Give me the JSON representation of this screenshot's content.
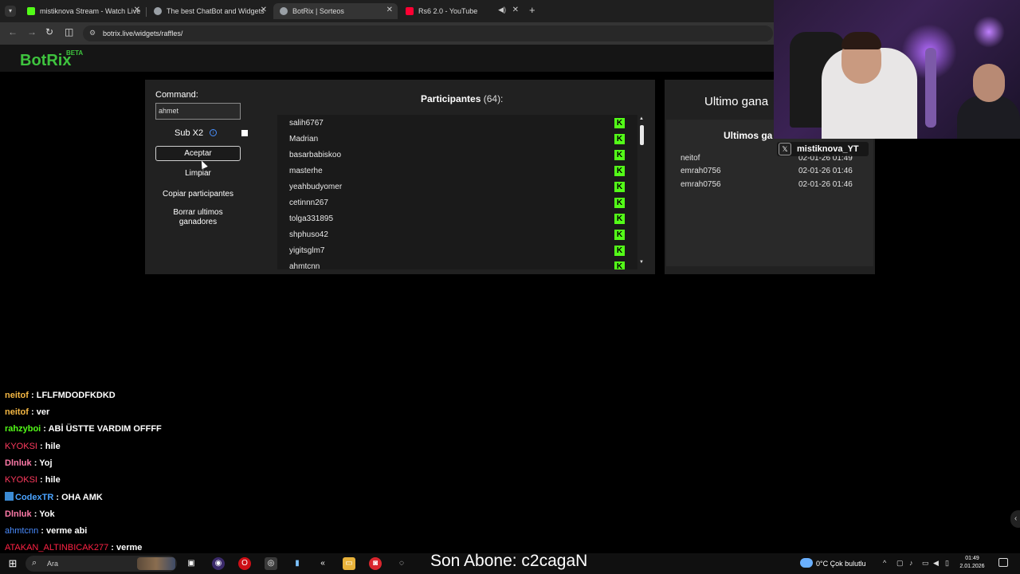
{
  "browser": {
    "tabs": [
      {
        "title": "mistiknova Stream - Watch Live",
        "color": "#53fc18"
      },
      {
        "title": "The best ChatBot and Widgets",
        "color": "#9aa0a6"
      },
      {
        "title": "BotRix | Sorteos",
        "color": "#9aa0a6"
      },
      {
        "title": "Rs6 2.0 - YouTube",
        "color": "#ff0033"
      }
    ],
    "close_glyph": "✕",
    "new_tab_glyph": "+",
    "url": "botrix.live/widgets/raffles/"
  },
  "app": {
    "logo": "BotRix",
    "logo_badge": "BETA",
    "command_label": "Command:",
    "command_value": "ahmet",
    "sub_label": "Sub X2",
    "buttons": {
      "accept": "Aceptar",
      "clear": "Limpiar",
      "copy": "Copiar participantes",
      "delete": "Borrar ultimos ganadores"
    },
    "participants_title": "Participantes",
    "participants_count": "(64):",
    "participants": [
      "salih6767",
      "Madrian",
      "basarbabiskoo",
      "masterhe",
      "yeahbudyomer",
      "cetinnn267",
      "tolga331895",
      "shphuso42",
      "yigitsglm7",
      "ahmtcnn"
    ],
    "last_winner_title": "Ultimo gana",
    "winners_title": "Ultimos ga",
    "winners": [
      {
        "name": "neitof",
        "date": "02-01-26 01:49"
      },
      {
        "name": "emrah0756",
        "date": "02-01-26 01:46"
      },
      {
        "name": "emrah0756",
        "date": "02-01-26 01:46"
      }
    ]
  },
  "stream": {
    "cam_name": "mistiknova_YT",
    "sub_banner": "Son Abone: c2cagaN"
  },
  "chat": [
    {
      "user": "neitof",
      "color": "#f5b844",
      "msg": ": LFLFMDODFKDKD",
      "badge": false
    },
    {
      "user": "neitof",
      "color": "#f5b844",
      "msg": ": ver",
      "badge": false
    },
    {
      "user": "rahzyboi",
      "color": "#53fc18",
      "msg": ": ABİ ÜSTTE VARDIM OFFFF",
      "badge": false
    },
    {
      "user": "KYOKSI",
      "color": "#ff3a5e",
      "msg": ": hile",
      "badge": false
    },
    {
      "user": "Dlnluk",
      "color": "#ff7aa8",
      "msg": ": Yoj",
      "badge": false
    },
    {
      "user": "KYOKSI",
      "color": "#ff3a5e",
      "msg": ": hile",
      "badge": false
    },
    {
      "user": "CodexTR",
      "color": "#4aa3ff",
      "msg": ": OHA AMK",
      "badge": true
    },
    {
      "user": "Dlnluk",
      "color": "#ff7aa8",
      "msg": ": Yok",
      "badge": false
    },
    {
      "user": "ahmtcnn",
      "color": "#4a8cff",
      "msg": ": verme abi",
      "badge": false
    },
    {
      "user": "ATAKAN_ALTINBICAK277",
      "color": "#ff2244",
      "msg": ": verme",
      "badge": false
    }
  ],
  "taskbar": {
    "search_placeholder": "Ara",
    "weather": "0°C  Çok bulutlu",
    "time": "01:49",
    "date": "2.01.2026"
  }
}
